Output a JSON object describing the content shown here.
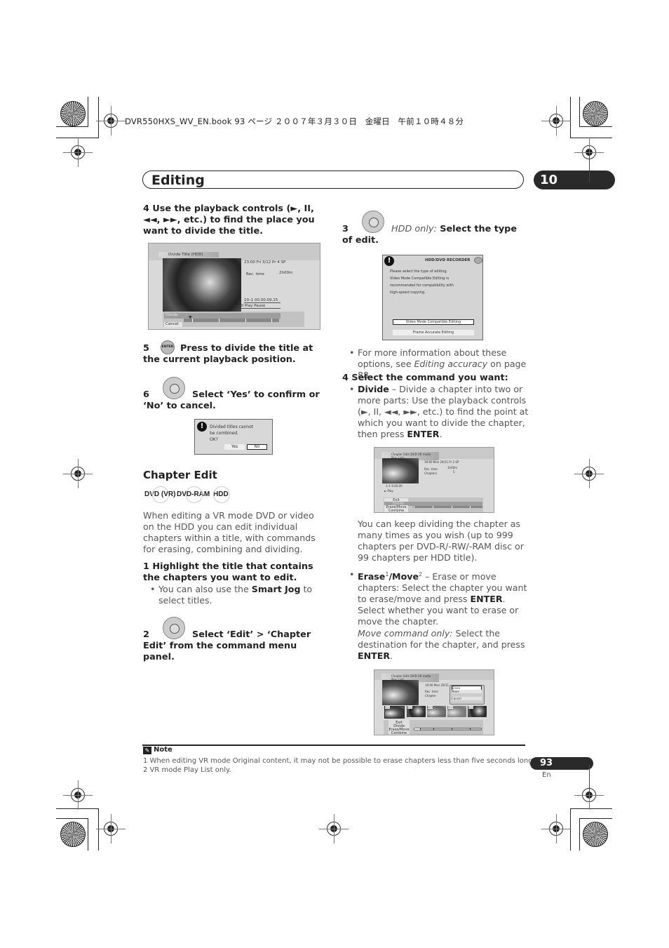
{
  "print_header": {
    "text": "DVR550HXS_WV_EN.book  93 ページ  ２００７年３月３０日　金曜日　午前１０時４８分"
  },
  "section": {
    "title": "Editing",
    "chapter_number": "10"
  },
  "left_column": {
    "step4": "4    Use the playback controls (►, II, ◄◄, ►►, etc.) to find the place you want to divide the title.",
    "divide_screen": {
      "title": "Divide Title  (HDD)",
      "info_line": "23:00  Fri  3/12  Pr 4    SP",
      "rec_time_label": "Rec. time",
      "rec_time_value": "2h00m",
      "position": "10–1    00.00.09.15",
      "status": "II Play Pause",
      "menu_divide": "Divide",
      "menu_cancel": "Cancel"
    },
    "step5_num": "5",
    "step5_icon_label": "ENTER",
    "step5_text": "Press to divide the title at the current playback position.",
    "step6_num": "6",
    "step6_text": "Select ‘Yes’ to confirm or ‘No’ to cancel.",
    "confirm_dialog": {
      "line1": "Divided titles cannot",
      "line2": "be combined.",
      "line3": "OK?",
      "yes": "Yes",
      "no": "No"
    },
    "chapter_edit_heading": "Chapter Edit",
    "badges": [
      "DVD (VR)",
      "DVD-RAM",
      "HDD"
    ],
    "intro": "When editing a VR mode DVD or video on the HDD you can edit individual chapters within a title, with commands for erasing, combining and dividing.",
    "step1": "1    Highlight the title that contains the chapters you want to edit.",
    "step1_bullet_pre": "You can also use the ",
    "step1_bullet_bold": "Smart Jog",
    "step1_bullet_post": " to select titles.",
    "step2_num": "2",
    "step2_text": "Select ‘Edit’ > ‘Chapter Edit’ from the command menu panel."
  },
  "right_column": {
    "step3_num": "3",
    "step3_italic": "HDD only:",
    "step3_bold": " Select the type of edit.",
    "edit_type_dialog": {
      "title": "HDD/DVD RECORDER",
      "message": [
        "Please select the type of editing.",
        "Video Mode Compatible Editing is",
        "recommended for compatibility with",
        "high-speed copying."
      ],
      "option1": "Video Mode Compatible Editing",
      "option2": "Frame Accurate Editing"
    },
    "info_bullet_pre": "For more information about these options, see ",
    "info_bullet_italic": "Editing accuracy",
    "info_bullet_post": " on page 88.",
    "step4": "4    Select the command you want:",
    "divide_bullet_bold": "Divide",
    "divide_bullet_text": " – Divide a chapter into two or more parts: Use the playback controls (►, II, ◄◄, ►►, etc.) to find the point at which you want to divide the chapter, then press ",
    "divide_bullet_enter": "ENTER",
    "chapter_screen1": {
      "title": "Chapter Edit (DVD VR mode Play List)",
      "info_line": "19:00  Mon  29/11  Pr 2    SP",
      "rec_time_label": "Rec. time",
      "rec_time_value": "1h00m",
      "chapters_label": "Chapters",
      "chapters_value": "5",
      "position": "1–1      0.00.00",
      "status": "► Play",
      "menu": [
        "Exit",
        "Divide",
        "Erase/Move",
        "Combine"
      ]
    },
    "divide_note": "You can keep dividing the chapter as many times as you wish (up to 999 chapters per DVD-R/-RW/-RAM disc or 99 chapters per HDD title).",
    "erase_bold1": "Erase",
    "erase_sup1": "1",
    "erase_bold2": "/Move",
    "erase_sup2": "2",
    "erase_text": " – Erase or move chapters: Select the chapter you want to erase/move and press ",
    "erase_enter": "ENTER",
    "erase_text2": ". Select whether you want to erase or move the chapter.",
    "move_italic": "Move command only:",
    "move_text": " Select the destination for the chapter, and press ",
    "move_enter": "ENTER",
    "chapter_screen2": {
      "title": "Chapter Edit (DVD VR mode Play List)",
      "info_line": "19:00  Mon  29/11",
      "rec_time_label": "Rec. time",
      "chapters_label": "Chapter",
      "popup": [
        "Erase",
        "Move",
        "Cancel"
      ],
      "thumbs": [
        "001",
        "002",
        "003",
        "004",
        "005"
      ],
      "menu": [
        "Exit",
        "Divide",
        "Erase/Move",
        "Combine"
      ]
    }
  },
  "footnote": {
    "heading": "Note",
    "items": [
      "1 When editing VR mode Original content, it may not be possible to erase chapters less than five seconds long.",
      "2 VR mode Play List only."
    ]
  },
  "page": {
    "number": "93",
    "lang": "En"
  }
}
